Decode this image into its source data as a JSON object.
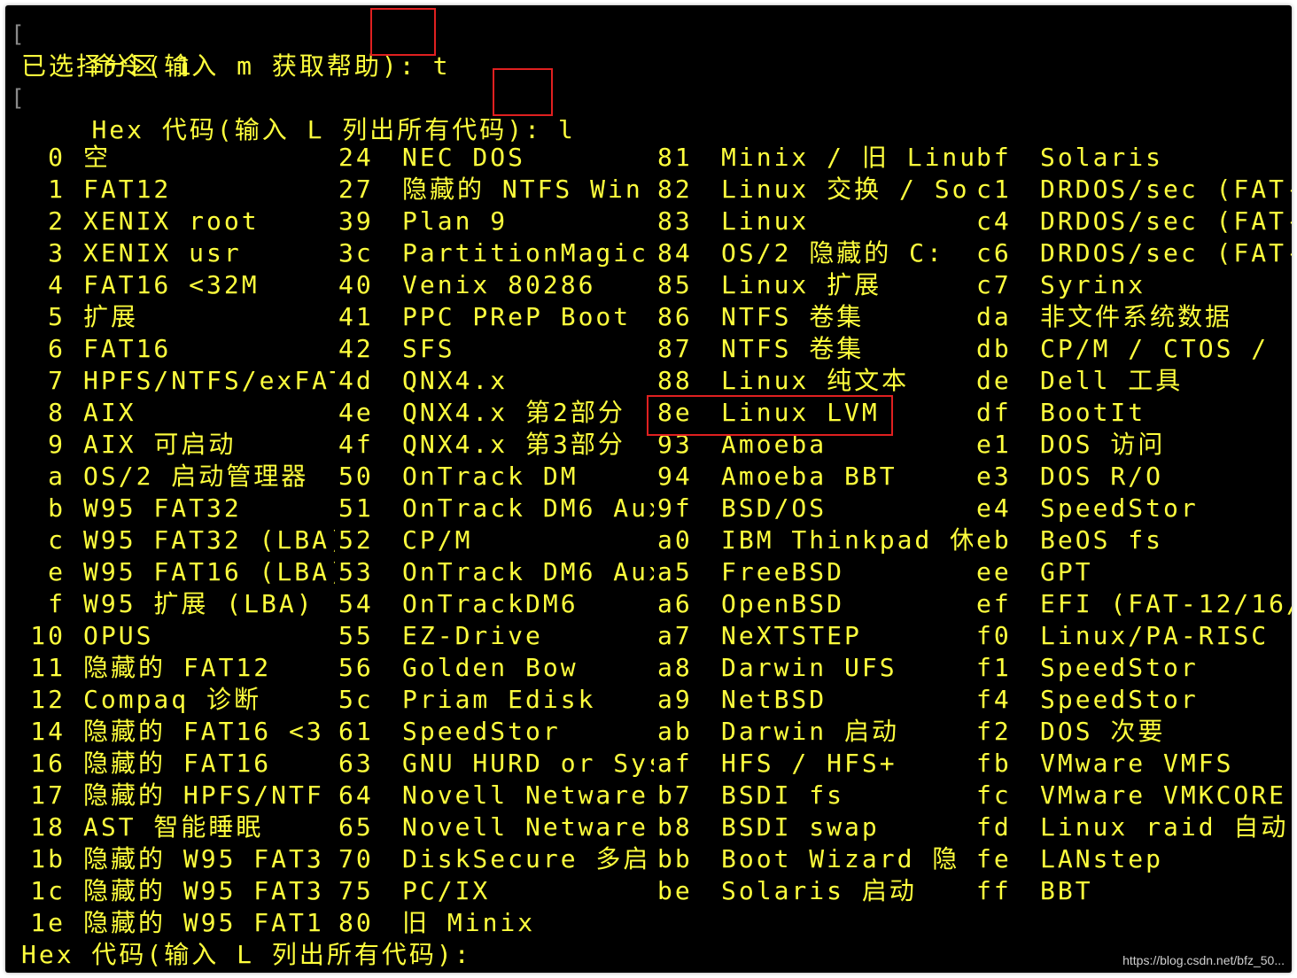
{
  "colors": {
    "background": "#000000",
    "text": "#ffff3d",
    "highlight_box": "#e02020"
  },
  "prompt1": {
    "label": "命令(输入 m 获取帮助):",
    "input": "t"
  },
  "selected_line": "已选择分区 1",
  "prompt2": {
    "label": "Hex 代码(输入 L 列出所有代码):",
    "input": "l"
  },
  "partition_types": [
    [
      {
        "code": "0",
        "name": "空"
      },
      {
        "code": "24",
        "name": "NEC DOS"
      },
      {
        "code": "81",
        "name": "Minix / 旧 Linu"
      },
      {
        "code": "bf",
        "name": "Solaris"
      }
    ],
    [
      {
        "code": "1",
        "name": "FAT12"
      },
      {
        "code": "27",
        "name": "隐藏的 NTFS Win"
      },
      {
        "code": "82",
        "name": "Linux 交换 / So"
      },
      {
        "code": "c1",
        "name": "DRDOS/sec (FAT-"
      }
    ],
    [
      {
        "code": "2",
        "name": "XENIX root"
      },
      {
        "code": "39",
        "name": "Plan 9"
      },
      {
        "code": "83",
        "name": "Linux"
      },
      {
        "code": "c4",
        "name": "DRDOS/sec (FAT-"
      }
    ],
    [
      {
        "code": "3",
        "name": "XENIX usr"
      },
      {
        "code": "3c",
        "name": "PartitionMagic"
      },
      {
        "code": "84",
        "name": "OS/2 隐藏的 C:"
      },
      {
        "code": "c6",
        "name": "DRDOS/sec (FAT-"
      }
    ],
    [
      {
        "code": "4",
        "name": "FAT16 <32M"
      },
      {
        "code": "40",
        "name": "Venix 80286"
      },
      {
        "code": "85",
        "name": "Linux 扩展"
      },
      {
        "code": "c7",
        "name": "Syrinx"
      }
    ],
    [
      {
        "code": "5",
        "name": "扩展"
      },
      {
        "code": "41",
        "name": "PPC PReP Boot"
      },
      {
        "code": "86",
        "name": "NTFS 卷集"
      },
      {
        "code": "da",
        "name": "非文件系统数据"
      }
    ],
    [
      {
        "code": "6",
        "name": "FAT16"
      },
      {
        "code": "42",
        "name": "SFS"
      },
      {
        "code": "87",
        "name": "NTFS 卷集"
      },
      {
        "code": "db",
        "name": "CP/M / CTOS / ."
      }
    ],
    [
      {
        "code": "7",
        "name": "HPFS/NTFS/exFAT"
      },
      {
        "code": "4d",
        "name": "QNX4.x"
      },
      {
        "code": "88",
        "name": "Linux 纯文本"
      },
      {
        "code": "de",
        "name": "Dell 工具"
      }
    ],
    [
      {
        "code": "8",
        "name": "AIX"
      },
      {
        "code": "4e",
        "name": "QNX4.x 第2部分"
      },
      {
        "code": "8e",
        "name": "Linux LVM"
      },
      {
        "code": "df",
        "name": "BootIt"
      }
    ],
    [
      {
        "code": "9",
        "name": "AIX 可启动"
      },
      {
        "code": "4f",
        "name": "QNX4.x 第3部分"
      },
      {
        "code": "93",
        "name": "Amoeba"
      },
      {
        "code": "e1",
        "name": "DOS 访问"
      }
    ],
    [
      {
        "code": "a",
        "name": "OS/2 启动管理器"
      },
      {
        "code": "50",
        "name": "OnTrack DM"
      },
      {
        "code": "94",
        "name": "Amoeba BBT"
      },
      {
        "code": "e3",
        "name": "DOS R/O"
      }
    ],
    [
      {
        "code": "b",
        "name": "W95 FAT32"
      },
      {
        "code": "51",
        "name": "OnTrack DM6 Aux"
      },
      {
        "code": "9f",
        "name": "BSD/OS"
      },
      {
        "code": "e4",
        "name": "SpeedStor"
      }
    ],
    [
      {
        "code": "c",
        "name": "W95 FAT32 (LBA)"
      },
      {
        "code": "52",
        "name": "CP/M"
      },
      {
        "code": "a0",
        "name": "IBM Thinkpad 休"
      },
      {
        "code": "eb",
        "name": "BeOS fs"
      }
    ],
    [
      {
        "code": "e",
        "name": "W95 FAT16 (LBA)"
      },
      {
        "code": "53",
        "name": "OnTrack DM6 Aux"
      },
      {
        "code": "a5",
        "name": "FreeBSD"
      },
      {
        "code": "ee",
        "name": "GPT"
      }
    ],
    [
      {
        "code": "f",
        "name": "W95 扩展 (LBA)"
      },
      {
        "code": "54",
        "name": "OnTrackDM6"
      },
      {
        "code": "a6",
        "name": "OpenBSD"
      },
      {
        "code": "ef",
        "name": "EFI (FAT-12/16/"
      }
    ],
    [
      {
        "code": "10",
        "name": "OPUS"
      },
      {
        "code": "55",
        "name": "EZ-Drive"
      },
      {
        "code": "a7",
        "name": "NeXTSTEP"
      },
      {
        "code": "f0",
        "name": "Linux/PA-RISC"
      }
    ],
    [
      {
        "code": "11",
        "name": "隐藏的 FAT12"
      },
      {
        "code": "56",
        "name": "Golden Bow"
      },
      {
        "code": "a8",
        "name": "Darwin UFS"
      },
      {
        "code": "f1",
        "name": "SpeedStor"
      }
    ],
    [
      {
        "code": "12",
        "name": "Compaq 诊断"
      },
      {
        "code": "5c",
        "name": "Priam Edisk"
      },
      {
        "code": "a9",
        "name": "NetBSD"
      },
      {
        "code": "f4",
        "name": "SpeedStor"
      }
    ],
    [
      {
        "code": "14",
        "name": "隐藏的 FAT16 <3"
      },
      {
        "code": "61",
        "name": "SpeedStor"
      },
      {
        "code": "ab",
        "name": "Darwin 启动"
      },
      {
        "code": "f2",
        "name": "DOS 次要"
      }
    ],
    [
      {
        "code": "16",
        "name": "隐藏的 FAT16"
      },
      {
        "code": "63",
        "name": "GNU HURD or Sys"
      },
      {
        "code": "af",
        "name": "HFS / HFS+"
      },
      {
        "code": "fb",
        "name": "VMware VMFS"
      }
    ],
    [
      {
        "code": "17",
        "name": "隐藏的 HPFS/NTF"
      },
      {
        "code": "64",
        "name": "Novell Netware"
      },
      {
        "code": "b7",
        "name": "BSDI fs"
      },
      {
        "code": "fc",
        "name": "VMware VMKCORE"
      }
    ],
    [
      {
        "code": "18",
        "name": "AST 智能睡眠"
      },
      {
        "code": "65",
        "name": "Novell Netware"
      },
      {
        "code": "b8",
        "name": "BSDI swap"
      },
      {
        "code": "fd",
        "name": "Linux raid 自动"
      }
    ],
    [
      {
        "code": "1b",
        "name": "隐藏的 W95 FAT3"
      },
      {
        "code": "70",
        "name": "DiskSecure 多启"
      },
      {
        "code": "bb",
        "name": "Boot Wizard 隐"
      },
      {
        "code": "fe",
        "name": "LANstep"
      }
    ],
    [
      {
        "code": "1c",
        "name": "隐藏的 W95 FAT3"
      },
      {
        "code": "75",
        "name": "PC/IX"
      },
      {
        "code": "be",
        "name": "Solaris 启动"
      },
      {
        "code": "ff",
        "name": "BBT"
      }
    ],
    [
      {
        "code": "1e",
        "name": "隐藏的 W95 FAT1"
      },
      {
        "code": "80",
        "name": "旧 Minix"
      },
      null,
      null
    ]
  ],
  "final_prompt": "Hex 代码(输入 L 列出所有代码):",
  "watermark": "https://blog.csdn.net/bfz_50..."
}
